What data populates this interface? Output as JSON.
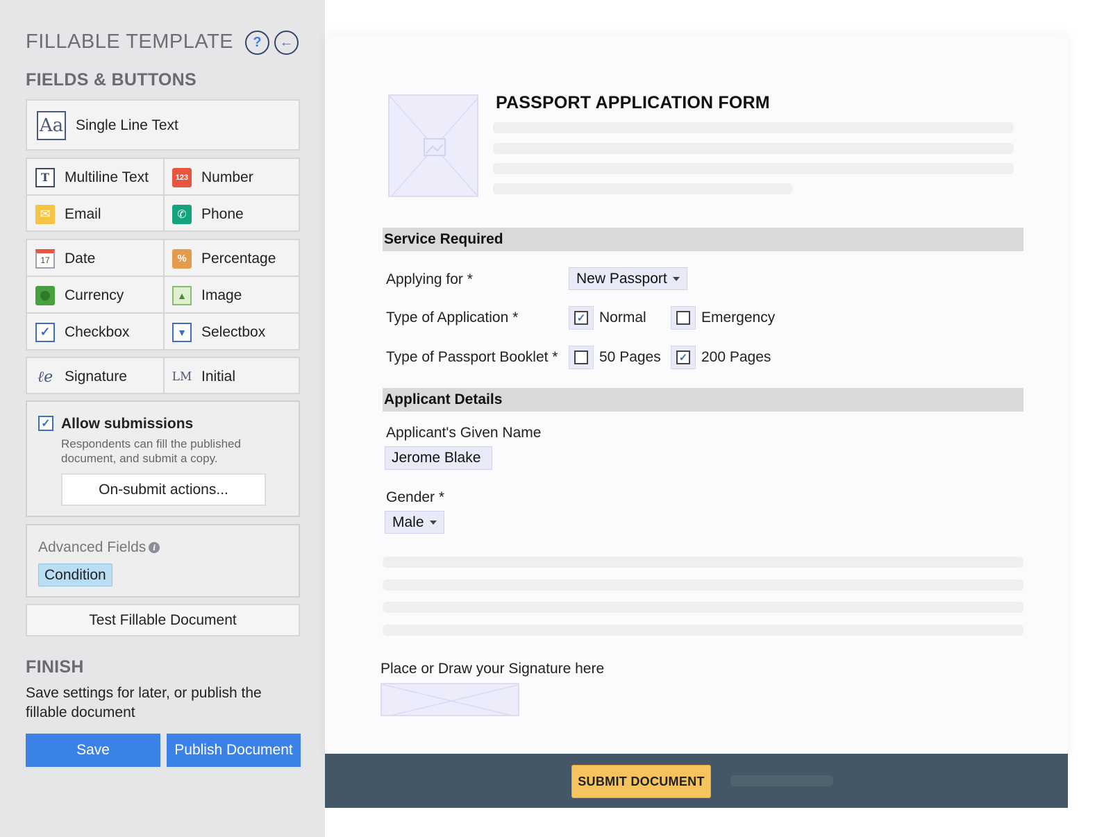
{
  "sidebar": {
    "title": "FILLABLE TEMPLATE",
    "help_icon": "?",
    "back_icon": "←",
    "fields_heading": "FIELDS & BUTTONS",
    "single_line": {
      "label": "Single Line Text",
      "icon": "Aa"
    },
    "fields": [
      {
        "label": "Multiline Text",
        "icon": "T"
      },
      {
        "label": "Number",
        "icon": "123"
      },
      {
        "label": "Email",
        "icon": "✉"
      },
      {
        "label": "Phone",
        "icon": "✆"
      },
      {
        "label": "Date",
        "icon": "17"
      },
      {
        "label": "Percentage",
        "icon": "%"
      },
      {
        "label": "Currency",
        "icon": ""
      },
      {
        "label": "Image",
        "icon": "▲"
      },
      {
        "label": "Checkbox",
        "icon": "✓"
      },
      {
        "label": "Selectbox",
        "icon": "▼"
      },
      {
        "label": "Signature",
        "icon": "ℓe"
      },
      {
        "label": "Initial",
        "icon": "LM"
      }
    ],
    "allow": {
      "checked_mark": "✓",
      "title": "Allow submissions",
      "desc": "Respondents can fill the published document, and submit a copy.",
      "button": "On-submit actions..."
    },
    "advanced": {
      "title": "Advanced Fields",
      "info_icon": "i",
      "condition": "Condition"
    },
    "test_button": "Test Fillable Document",
    "finish_heading": "FINISH",
    "finish_desc": "Save settings for later, or publish the fillable document",
    "save_button": "Save",
    "publish_button": "Publish Document"
  },
  "form": {
    "title": "PASSPORT APPLICATION FORM",
    "service_section": "Service Required",
    "applying_label": "Applying for *",
    "applying_value": "New Passport",
    "type_app_label": "Type of Application *",
    "type_app_options": [
      {
        "label": "Normal",
        "checked": true
      },
      {
        "label": "Emergency",
        "checked": false
      }
    ],
    "booklet_label": "Type of Passport Booklet *",
    "booklet_options": [
      {
        "label": "50 Pages",
        "checked": false
      },
      {
        "label": "200 Pages",
        "checked": true
      }
    ],
    "check_mark": "✓",
    "applicant_section": "Applicant Details",
    "given_name_label": "Applicant's Given Name",
    "given_name_value": "Jerome Blake",
    "gender_label": "Gender *",
    "gender_value": "Male",
    "signature_label": "Place or Draw your Signature here",
    "submit_button": "SUBMIT DOCUMENT"
  },
  "colors": {
    "accent_blue": "#3b82e6",
    "submit_yellow": "#f6c45f",
    "footer_bg": "#455766",
    "sidebar_bg": "#e6e6e8"
  }
}
